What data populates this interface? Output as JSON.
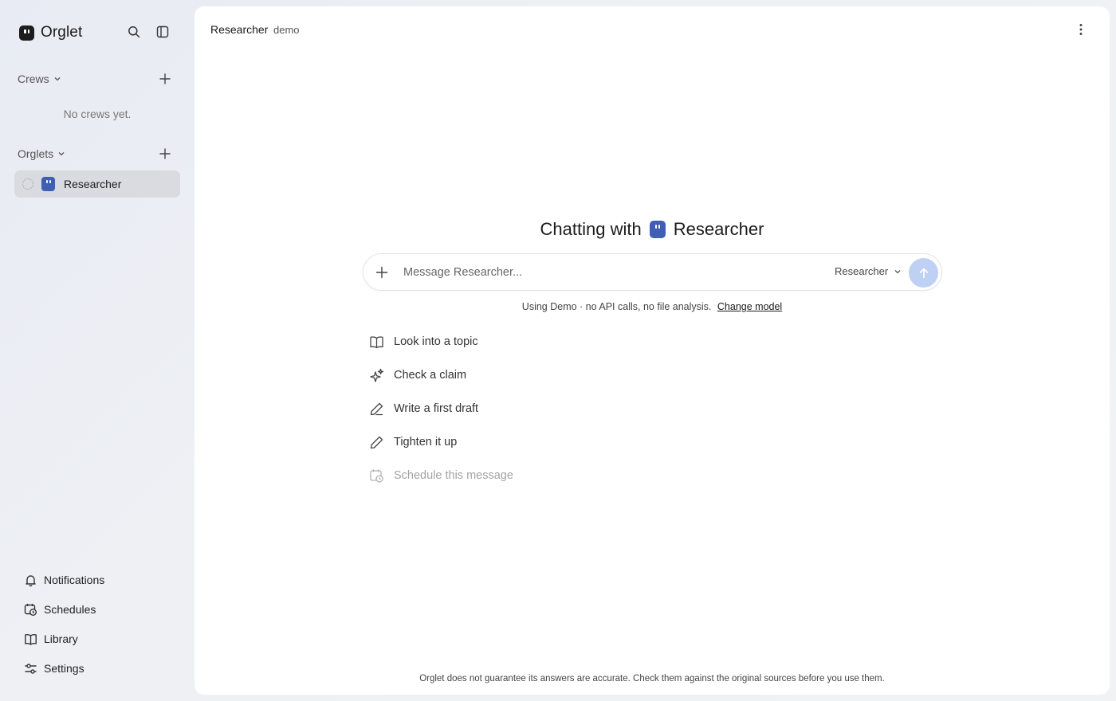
{
  "sidebar": {
    "brand": "Orglet",
    "crews": {
      "label": "Crews",
      "empty_text": "No crews yet."
    },
    "orglets": {
      "label": "Orglets",
      "items": [
        {
          "label": "Researcher"
        }
      ]
    },
    "bottom_nav": [
      {
        "label": "Notifications",
        "icon": "bell-icon"
      },
      {
        "label": "Schedules",
        "icon": "calendar-clock-icon"
      },
      {
        "label": "Library",
        "icon": "book-icon"
      },
      {
        "label": "Settings",
        "icon": "sliders-icon"
      }
    ]
  },
  "main": {
    "title": "Researcher",
    "badge": "demo",
    "hero": {
      "prefix": "Chatting with",
      "name": "Researcher"
    },
    "composer": {
      "placeholder": "Message Researcher...",
      "model_label": "Researcher"
    },
    "model_note": {
      "text": "Using Demo · no API calls, no file analysis.",
      "link": "Change model"
    },
    "suggestions": [
      {
        "label": "Look into a topic",
        "icon": "book-open-icon",
        "enabled": true
      },
      {
        "label": "Check a claim",
        "icon": "sparkle-icon",
        "enabled": true
      },
      {
        "label": "Write a first draft",
        "icon": "pencil-icon",
        "enabled": true
      },
      {
        "label": "Tighten it up",
        "icon": "pencil-icon",
        "enabled": true
      },
      {
        "label": "Schedule this message",
        "icon": "calendar-clock-icon",
        "enabled": false
      }
    ],
    "disclaimer": "Orglet does not guarantee its answers are accurate. Check them against the original sources before you use them."
  },
  "colors": {
    "accent_avatar": "#3f5fb2",
    "send_button": "#bfd0f5",
    "selected_item_bg": "#d9dbe1"
  }
}
